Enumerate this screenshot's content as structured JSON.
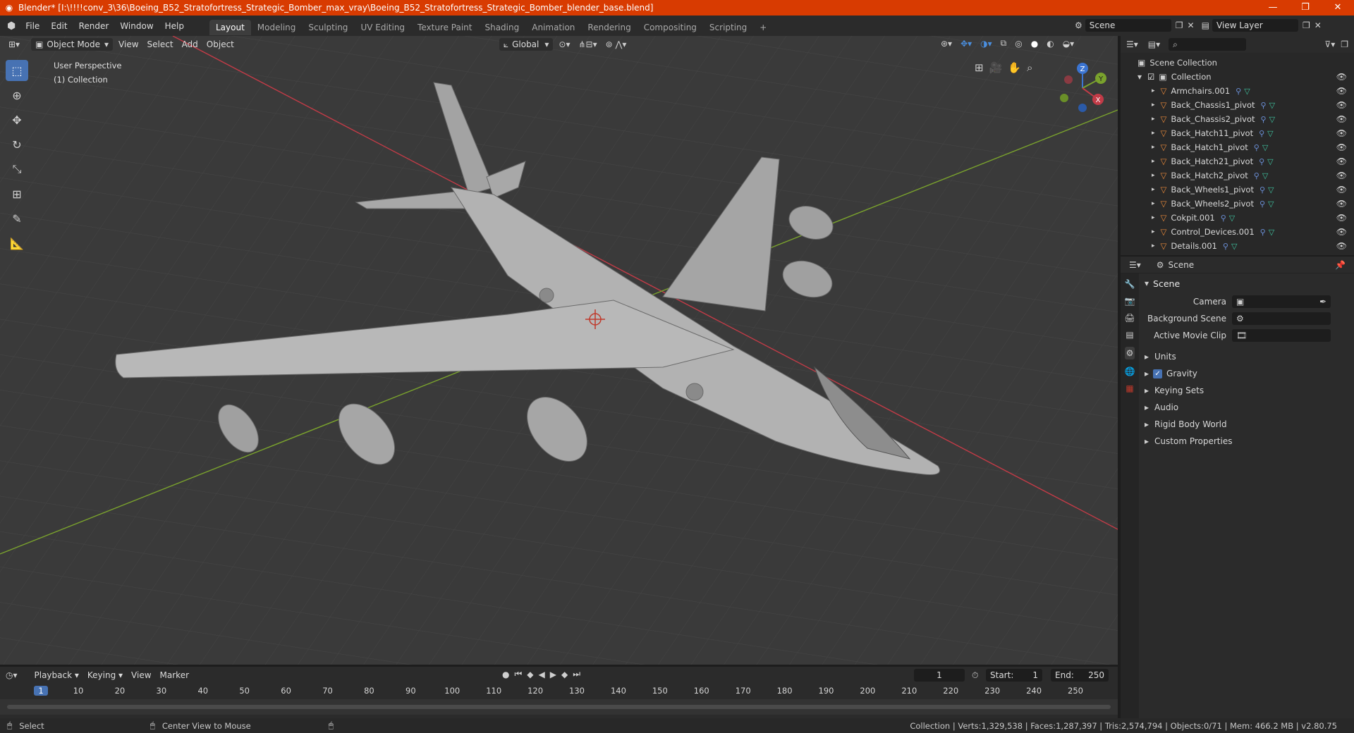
{
  "window": {
    "title": "Blender* [I:\\!!!!conv_3\\36\\Boeing_B52_Stratofortress_Strategic_Bomber_max_vray\\Boeing_B52_Stratofortress_Strategic_Bomber_blender_base.blend]",
    "controls": [
      "—",
      "❐",
      "✕"
    ]
  },
  "menu": [
    "File",
    "Edit",
    "Render",
    "Window",
    "Help"
  ],
  "workspaces": [
    "Layout",
    "Modeling",
    "Sculpting",
    "UV Editing",
    "Texture Paint",
    "Shading",
    "Animation",
    "Rendering",
    "Compositing",
    "Scripting"
  ],
  "active_workspace": "Layout",
  "scene_field": "Scene",
  "view_layer_field": "View Layer",
  "viewport": {
    "mode": "Object Mode",
    "menus": [
      "View",
      "Select",
      "Add",
      "Object"
    ],
    "transform_orientation": "Global",
    "overlay_text_1": "User Perspective",
    "overlay_text_2": "(1) Collection",
    "gizmo_axes": {
      "x": "X",
      "y": "Y",
      "z": "Z"
    },
    "colors": {
      "bg": "#3a3a3a",
      "x_axis": "#c23b47",
      "y_axis": "#7aa22d",
      "z_axis": "#3b74d1"
    }
  },
  "outliner": {
    "root": "Scene Collection",
    "collection": "Collection",
    "items": [
      "Armchairs.001",
      "Back_Chassis1_pivot",
      "Back_Chassis2_pivot",
      "Back_Hatch11_pivot",
      "Back_Hatch1_pivot",
      "Back_Hatch21_pivot",
      "Back_Hatch2_pivot",
      "Back_Wheels1_pivot",
      "Back_Wheels2_pivot",
      "Cokpit.001",
      "Control_Devices.001",
      "Details.001"
    ]
  },
  "properties": {
    "context": "Scene",
    "section": "Scene",
    "fields": [
      {
        "label": "Camera"
      },
      {
        "label": "Background Scene"
      },
      {
        "label": "Active Movie Clip"
      }
    ],
    "panels": [
      "Units",
      "Gravity",
      "Keying Sets",
      "Audio",
      "Rigid Body World",
      "Custom Properties"
    ],
    "gravity_checked": true
  },
  "timeline": {
    "menus": [
      "Playback",
      "Keying",
      "View",
      "Marker"
    ],
    "current_frame": "1",
    "start_label": "Start:",
    "start": "1",
    "end_label": "End:",
    "end": "250",
    "ticks": [
      "1",
      "10",
      "20",
      "30",
      "40",
      "50",
      "60",
      "70",
      "80",
      "90",
      "100",
      "110",
      "120",
      "130",
      "140",
      "150",
      "160",
      "170",
      "180",
      "190",
      "200",
      "210",
      "220",
      "230",
      "240",
      "250"
    ]
  },
  "status": {
    "left1": "Select",
    "left2": "Center View to Mouse",
    "right": "Collection | Verts:1,329,538 | Faces:1,287,397 | Tris:2,574,794 | Objects:0/71 | Mem: 466.2 MB | v2.80.75"
  }
}
